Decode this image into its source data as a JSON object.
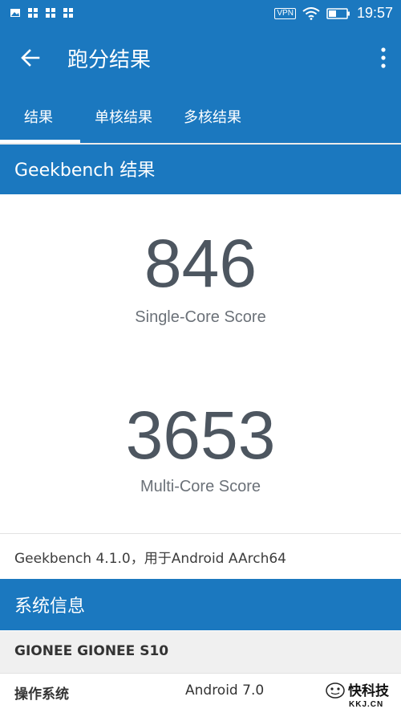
{
  "status_bar": {
    "vpn_label": "VPN",
    "time": "19:57",
    "icons": [
      "image-icon",
      "app-grid-icon",
      "app-grid-icon",
      "app-grid-icon",
      "wifi-icon",
      "battery-icon"
    ]
  },
  "app_bar": {
    "title": "跑分结果"
  },
  "tabs": [
    {
      "label": "结果",
      "active": true
    },
    {
      "label": "单核结果",
      "active": false
    },
    {
      "label": "多核结果",
      "active": false
    }
  ],
  "results": {
    "section_title": "Geekbench 结果",
    "single_core_score": "846",
    "single_core_label": "Single-Core Score",
    "multi_core_score": "3653",
    "multi_core_label": "Multi-Core Score"
  },
  "version_text": "Geekbench 4.1.0，用于Android AArch64",
  "system_info": {
    "section_title": "系统信息",
    "device_name": "GIONEE GIONEE S10",
    "rows": [
      {
        "key": "操作系统",
        "value": "Android 7.0"
      }
    ]
  },
  "watermark": {
    "text": "快科技",
    "sub": "KKJ.CN"
  },
  "colors": {
    "primary": "#1b78bf",
    "score_text": "#4d5660"
  }
}
